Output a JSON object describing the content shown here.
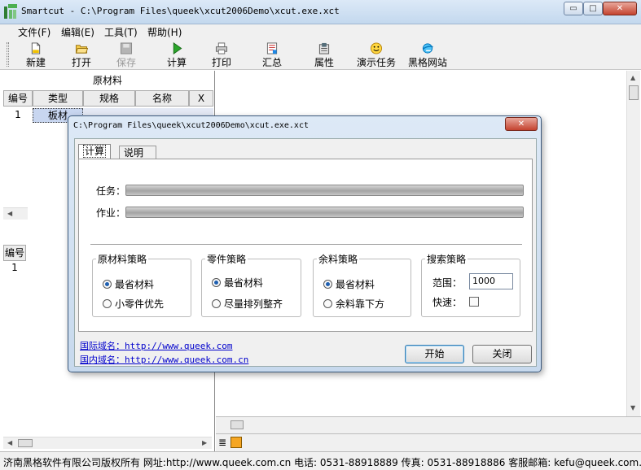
{
  "window": {
    "title": "Smartcut - C:\\Program Files\\queek\\xcut2006Demo\\xcut.exe.xct"
  },
  "menu": [
    "文件(F)",
    "编辑(E)",
    "工具(T)",
    "帮助(H)"
  ],
  "toolbar": {
    "new": "新建",
    "open": "打开",
    "save": "保存",
    "calc": "计算",
    "print": "打印",
    "summary": "汇总",
    "props": "属性",
    "demo": "演示任务",
    "site": "黑格网站"
  },
  "left_grid": {
    "title": "原材料",
    "headers": [
      "编号",
      "类型",
      "规格",
      "名称",
      "X"
    ],
    "row1": {
      "no": "1",
      "type": "板材"
    },
    "second": {
      "header": "编号",
      "row1": "1"
    }
  },
  "dialog": {
    "title": "C:\\Program Files\\queek\\xcut2006Demo\\xcut.exe.xct",
    "tabs": [
      "计算",
      "说明"
    ],
    "task_label": "任务：",
    "job_label": "作业：",
    "task_progress": 1.0,
    "job_progress": 1.0,
    "groups": {
      "material": {
        "title": "原材料策略",
        "opt1": "最省材料",
        "opt2": "小零件优先",
        "selected": 1
      },
      "parts": {
        "title": "零件策略",
        "opt1": "最省材料",
        "opt2": "尽量排列整齐",
        "selected": 1
      },
      "remnant": {
        "title": "余料策略",
        "opt1": "最省材料",
        "opt2": "余料靠下方",
        "selected": 1
      },
      "search": {
        "title": "搜索策略",
        "range_label": "范围：",
        "range_value": "1000",
        "fast_label": "快速："
      }
    },
    "link_intl_label": "国际域名：",
    "link_intl_url": "http://www.queek.com",
    "link_cn_label": "国内域名：",
    "link_cn_url": "http://www.queek.com.cn",
    "start_button": "开始",
    "close_button": "关闭"
  },
  "status": {
    "text": "济南黑格软件有限公司版权所有 网址:http://www.queek.com.cn  电话: 0531-88918889 传真: 0531-88918886 客服邮箱: kefu@queek.com.cn"
  },
  "colors": {
    "title_gradient": "#c3d8ee",
    "close_red": "#c4432f",
    "link": "#0000cc"
  }
}
